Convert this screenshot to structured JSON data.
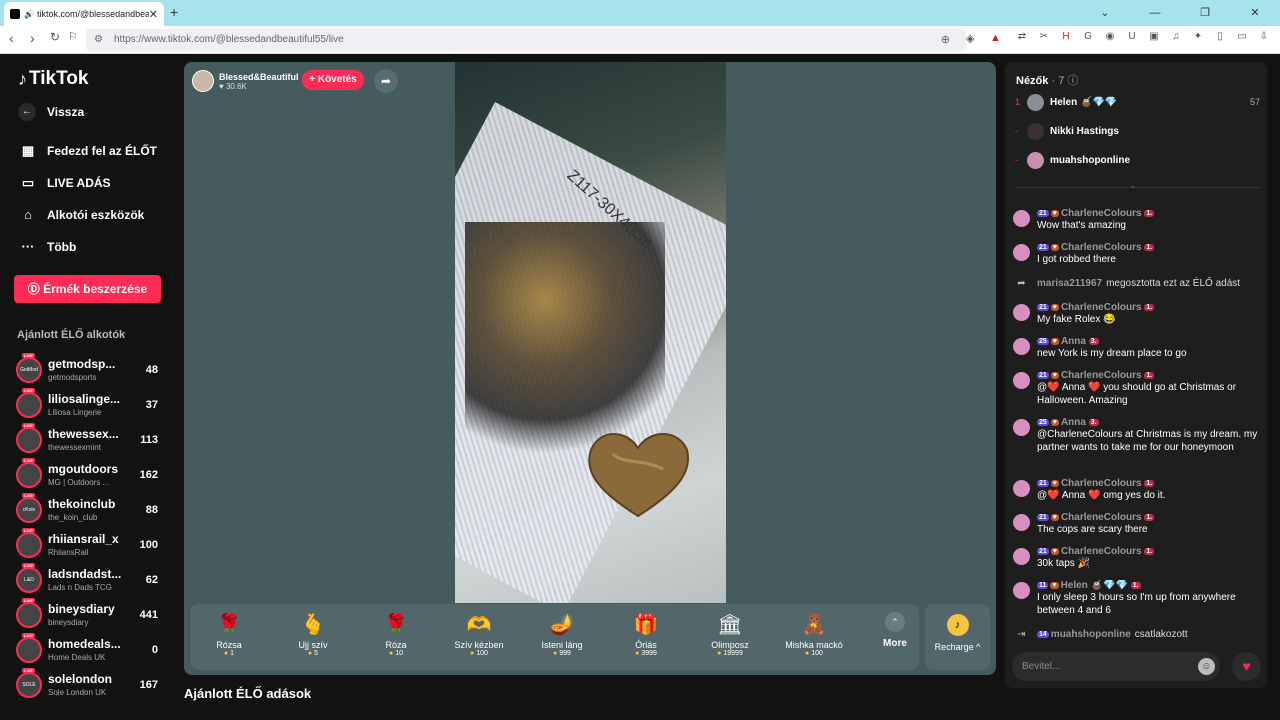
{
  "browser": {
    "tab_title": "tiktok.com/@blessedandbea",
    "url": "https://www.tiktok.com/@blessedandbeautiful55/live",
    "new_tab": "+"
  },
  "sidebar": {
    "logo": "TikTok",
    "back": "Vissza",
    "nav": [
      {
        "label": "Fedezd fel az ÉLŐT",
        "icon": "calendar-live-icon"
      },
      {
        "label": "LIVE ADÁS",
        "icon": "video-camera-icon"
      },
      {
        "label": "Alkotói eszközök",
        "icon": "creator-tools-icon"
      },
      {
        "label": "Több",
        "icon": "more-dots-icon"
      }
    ],
    "coins_button": "Érmék beszerzése",
    "recommended_title": "Ajánlott ÉLŐ alkotók",
    "live_badge": "LIVE",
    "recommended": [
      {
        "name": "getmodsp...",
        "sub": "getmodsports",
        "count": "48",
        "avatar": "GetMod"
      },
      {
        "name": "liliosalinge...",
        "sub": "Liliosa Lingerie",
        "count": "37",
        "avatar": ""
      },
      {
        "name": "thewessex...",
        "sub": "thewessexmint",
        "count": "113",
        "avatar": ""
      },
      {
        "name": "mgoutdoors",
        "sub": "MG | Outdoors ...",
        "count": "162",
        "avatar": ""
      },
      {
        "name": "thekoinclub",
        "sub": "the_koin_club",
        "count": "88",
        "avatar": "cKoin"
      },
      {
        "name": "rhiiansrail_x",
        "sub": "RhiiansRail",
        "count": "100",
        "avatar": ""
      },
      {
        "name": "ladsndadst...",
        "sub": "Lads n Dads TCG",
        "count": "62",
        "avatar": "L&D"
      },
      {
        "name": "bineysdiary",
        "sub": "bineysdiary",
        "count": "441",
        "avatar": ""
      },
      {
        "name": "homedeals...",
        "sub": "Home Deals UK",
        "count": "0",
        "avatar": ""
      },
      {
        "name": "solelondon",
        "sub": "Sole London UK",
        "count": "167",
        "avatar": "SOLE"
      }
    ]
  },
  "player": {
    "host_name": "Blessed&Beautiful",
    "host_likes": "♥ 30.6K",
    "follow_label": "+ Követés",
    "video_text": "Z117-30X40cm",
    "gifts": [
      {
        "name": "Rózsa",
        "price": "1",
        "icon": "🌹"
      },
      {
        "name": "Ujj szív",
        "price": "5",
        "icon": "🫰"
      },
      {
        "name": "Róza",
        "price": "10",
        "icon": "🌹"
      },
      {
        "name": "Szív kézben",
        "price": "100",
        "icon": "🫶"
      },
      {
        "name": "Isteni láng",
        "price": "999",
        "icon": "🪔"
      },
      {
        "name": "Óriás",
        "price": "3999",
        "icon": "🎁"
      },
      {
        "name": "Olimposz",
        "price": "19999",
        "icon": "🏛"
      },
      {
        "name": "Mishka mackó",
        "price": "100",
        "icon": "🧸"
      }
    ],
    "more_label": "More",
    "recharge_label": "Recharge ^"
  },
  "below_title": "Ajánlott ÉLŐ adások",
  "chat": {
    "viewers_title": "Nézők",
    "viewers_count": "· 7",
    "viewers": [
      {
        "rank": "1",
        "name": "Helen 🧉💎💎",
        "score": "57",
        "color": "#8a8f96"
      },
      {
        "rank": "-",
        "name": "Nikki Hastings",
        "score": "",
        "color": "#3a3030"
      },
      {
        "rank": "-",
        "name": "muahshoponline",
        "score": "",
        "color": "#c98fb0"
      }
    ],
    "messages": [
      {
        "level": "21",
        "user": "CharleneColours",
        "gift": "1.",
        "text": "Wow that's amazing"
      },
      {
        "level": "21",
        "user": "CharleneColours",
        "gift": "1.",
        "text": "I got robbed there"
      },
      {
        "level": "21",
        "user": "CharleneColours",
        "gift": "1.",
        "text": "My fake Rolex 😂"
      },
      {
        "level": "25",
        "user": "Anna",
        "gift": "3.",
        "text": "new York is my dream place to go"
      },
      {
        "level": "21",
        "user": "CharleneColours",
        "gift": "1.",
        "text": "@❤️ Anna ❤️ you should go at Christmas or Halloween. Amazing"
      },
      {
        "level": "25",
        "user": "Anna",
        "gift": "3.",
        "text": "@CharleneColours at Christmas is my dream. my partner wants to take me for our honeymoon"
      },
      {
        "level": "21",
        "user": "CharleneColours",
        "gift": "1.",
        "text": "@❤️ Anna ❤️ omg yes do it."
      },
      {
        "level": "21",
        "user": "CharleneColours",
        "gift": "1.",
        "text": "The cops are scary there"
      },
      {
        "level": "21",
        "user": "CharleneColours",
        "gift": "1.",
        "text": "30k taps 🎉"
      },
      {
        "level": "11",
        "user": "Helen 🧉💎💎",
        "gift": "1.",
        "text": "I only sleep 3 hours so I'm up from anywhere between 4 and 6"
      }
    ],
    "share_user": "marisa211967",
    "share_text": "megosztotta ezt az ÉLŐ adást",
    "join_level": "14",
    "join_user": "muahshoponline",
    "join_text": "csatlakozott",
    "input_placeholder": "Bevitel..."
  },
  "colors": {
    "accent": "#fe2c55",
    "player_bg": "#465b5e",
    "coin": "#f5c542"
  }
}
